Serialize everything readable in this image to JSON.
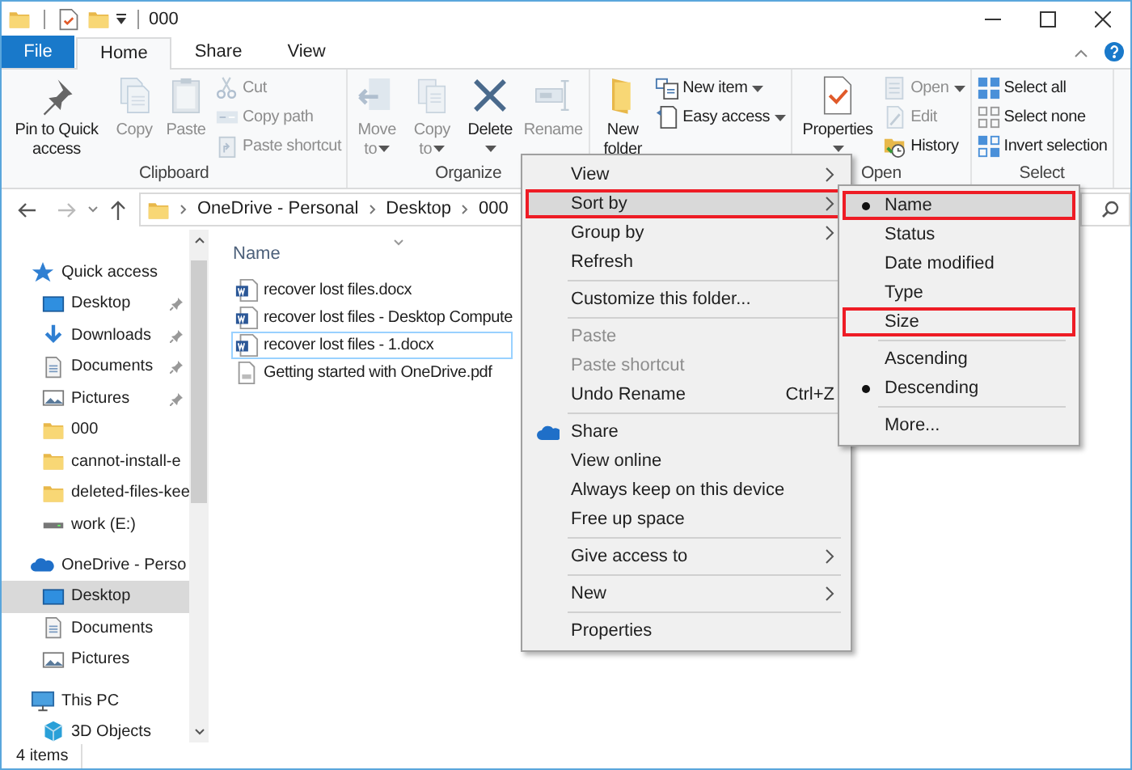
{
  "title_bar": {
    "title": "000"
  },
  "tabs": [
    {
      "label": "File",
      "kind": "file",
      "selected": false
    },
    {
      "label": "Home",
      "kind": "tab",
      "selected": true
    },
    {
      "label": "Share",
      "kind": "tab",
      "selected": false
    },
    {
      "label": "View",
      "kind": "tab",
      "selected": false
    }
  ],
  "ribbon": {
    "groups": [
      {
        "label": "Clipboard",
        "items": [
          {
            "label": "Pin to Quick access",
            "kind": "large",
            "disabled": false,
            "dropdown": false
          },
          {
            "label": "Copy",
            "kind": "large",
            "disabled": true,
            "dropdown": false
          },
          {
            "label": "Paste",
            "kind": "large",
            "disabled": true,
            "dropdown": false
          },
          {
            "label": "Cut",
            "kind": "small",
            "disabled": true,
            "dropdown": false
          },
          {
            "label": "Copy path",
            "kind": "small",
            "disabled": true,
            "dropdown": false
          },
          {
            "label": "Paste shortcut",
            "kind": "small",
            "disabled": true,
            "dropdown": false
          }
        ]
      },
      {
        "label": "Organize",
        "items": [
          {
            "label": "Move to",
            "kind": "large",
            "disabled": true,
            "dropdown": true
          },
          {
            "label": "Copy to",
            "kind": "large",
            "disabled": true,
            "dropdown": true
          },
          {
            "label": "Delete",
            "kind": "large",
            "disabled": false,
            "dropdown": true
          },
          {
            "label": "Rename",
            "kind": "large",
            "disabled": true,
            "dropdown": false
          }
        ]
      },
      {
        "items": [
          {
            "label": "New folder",
            "kind": "large",
            "disabled": false,
            "dropdown": false
          },
          {
            "label": "New item",
            "kind": "small",
            "disabled": false,
            "dropdown": true
          },
          {
            "label": "Easy access",
            "kind": "small",
            "disabled": false,
            "dropdown": true
          }
        ]
      },
      {
        "label": "Open",
        "items": [
          {
            "label": "Properties",
            "kind": "large",
            "disabled": false,
            "dropdown": true
          },
          {
            "label": "Open",
            "kind": "small",
            "disabled": true,
            "dropdown": true
          },
          {
            "label": "Edit",
            "kind": "small",
            "disabled": true,
            "dropdown": false
          },
          {
            "label": "History",
            "kind": "small",
            "disabled": false,
            "dropdown": false
          }
        ]
      },
      {
        "label": "Select",
        "items": [
          {
            "label": "Select all",
            "kind": "small",
            "disabled": false,
            "dropdown": false
          },
          {
            "label": "Select none",
            "kind": "small",
            "disabled": false,
            "dropdown": false
          },
          {
            "label": "Invert selection",
            "kind": "small",
            "disabled": false,
            "dropdown": false
          }
        ]
      }
    ]
  },
  "address": {
    "path": [
      "OneDrive - Personal",
      "Desktop",
      "000"
    ]
  },
  "nav": {
    "items": [
      {
        "label": "Quick access",
        "selected": false,
        "children": [
          {
            "label": "Desktop",
            "pinned": true,
            "selected": false
          },
          {
            "label": "Downloads",
            "pinned": true,
            "selected": false
          },
          {
            "label": "Documents",
            "pinned": true,
            "selected": false
          },
          {
            "label": "Pictures",
            "pinned": true,
            "selected": false
          },
          {
            "label": "000",
            "pinned": false,
            "selected": false
          },
          {
            "label": "cannot-install-e",
            "pinned": false,
            "selected": false
          },
          {
            "label": "deleted-files-kee",
            "pinned": false,
            "selected": false
          },
          {
            "label": "work (E:)",
            "pinned": false,
            "selected": false
          }
        ]
      },
      {
        "label": "OneDrive - Perso",
        "selected": false,
        "children": [
          {
            "label": "Desktop",
            "pinned": false,
            "selected": true
          },
          {
            "label": "Documents",
            "pinned": false,
            "selected": false
          },
          {
            "label": "Pictures",
            "pinned": false,
            "selected": false
          }
        ]
      },
      {
        "label": "This PC",
        "selected": false,
        "children": [
          {
            "label": "3D Objects",
            "pinned": false,
            "selected": false
          }
        ]
      }
    ]
  },
  "files": {
    "columns": [
      "Name"
    ],
    "rows": [
      {
        "name": "recover lost files.docx",
        "kind": "word",
        "focused": false
      },
      {
        "name": "recover lost files - Desktop Compute",
        "kind": "word",
        "focused": false
      },
      {
        "name": "recover lost files - 1.docx",
        "kind": "word",
        "focused": true
      },
      {
        "name": "Getting started with OneDrive.pdf",
        "kind": "pdf",
        "focused": false
      }
    ]
  },
  "status_bar": {
    "text": "4 items"
  },
  "context_menu": {
    "items": [
      {
        "kind": "item",
        "label": "View",
        "disabled": false,
        "hovered": false,
        "outlined": false,
        "submenu": true
      },
      {
        "kind": "item",
        "label": "Sort by",
        "disabled": false,
        "hovered": true,
        "outlined": true,
        "submenu": true
      },
      {
        "kind": "item",
        "label": "Group by",
        "disabled": false,
        "hovered": false,
        "outlined": false,
        "submenu": true
      },
      {
        "kind": "item",
        "label": "Refresh",
        "disabled": false,
        "hovered": false,
        "outlined": false,
        "submenu": false
      },
      {
        "kind": "separator"
      },
      {
        "kind": "item",
        "label": "Customize this folder...",
        "disabled": false,
        "hovered": false,
        "outlined": false,
        "submenu": false
      },
      {
        "kind": "separator"
      },
      {
        "kind": "item",
        "label": "Paste",
        "disabled": true,
        "hovered": false,
        "outlined": false,
        "submenu": false
      },
      {
        "kind": "item",
        "label": "Paste shortcut",
        "disabled": true,
        "hovered": false,
        "outlined": false,
        "submenu": false
      },
      {
        "kind": "item",
        "label": "Undo Rename",
        "shortcut": "Ctrl+Z",
        "disabled": false,
        "hovered": false,
        "outlined": false,
        "submenu": false
      },
      {
        "kind": "separator"
      },
      {
        "kind": "cloud",
        "label": "Share",
        "disabled": false,
        "hovered": false,
        "outlined": false,
        "submenu": false
      },
      {
        "kind": "item",
        "label": "View online",
        "disabled": false,
        "hovered": false,
        "outlined": false,
        "submenu": false
      },
      {
        "kind": "item",
        "label": "Always keep on this device",
        "disabled": false,
        "hovered": false,
        "outlined": false,
        "submenu": false
      },
      {
        "kind": "item",
        "label": "Free up space",
        "disabled": false,
        "hovered": false,
        "outlined": false,
        "submenu": false
      },
      {
        "kind": "separator"
      },
      {
        "kind": "item",
        "label": "Give access to",
        "disabled": false,
        "hovered": false,
        "outlined": false,
        "submenu": true
      },
      {
        "kind": "separator"
      },
      {
        "kind": "item",
        "label": "New",
        "disabled": false,
        "hovered": false,
        "outlined": false,
        "submenu": true
      },
      {
        "kind": "separator"
      },
      {
        "kind": "item",
        "label": "Properties",
        "disabled": false,
        "hovered": false,
        "outlined": false,
        "submenu": false
      }
    ]
  },
  "sort_menu": {
    "items": [
      {
        "kind": "item",
        "label": "Name",
        "checked": true,
        "hovered": true,
        "outlined": true
      },
      {
        "kind": "item",
        "label": "Status",
        "checked": false,
        "hovered": false,
        "outlined": false
      },
      {
        "kind": "item",
        "label": "Date modified",
        "checked": false,
        "hovered": false,
        "outlined": false
      },
      {
        "kind": "item",
        "label": "Type",
        "checked": false,
        "hovered": false,
        "outlined": false
      },
      {
        "kind": "item",
        "label": "Size",
        "checked": false,
        "hovered": false,
        "outlined": true
      },
      {
        "kind": "separator"
      },
      {
        "kind": "item",
        "label": "Ascending",
        "checked": false,
        "hovered": false,
        "outlined": false
      },
      {
        "kind": "item",
        "label": "Descending",
        "checked": true,
        "hovered": false,
        "outlined": false
      },
      {
        "kind": "separator"
      },
      {
        "kind": "item",
        "label": "More...",
        "checked": false,
        "hovered": false,
        "outlined": false
      }
    ]
  }
}
